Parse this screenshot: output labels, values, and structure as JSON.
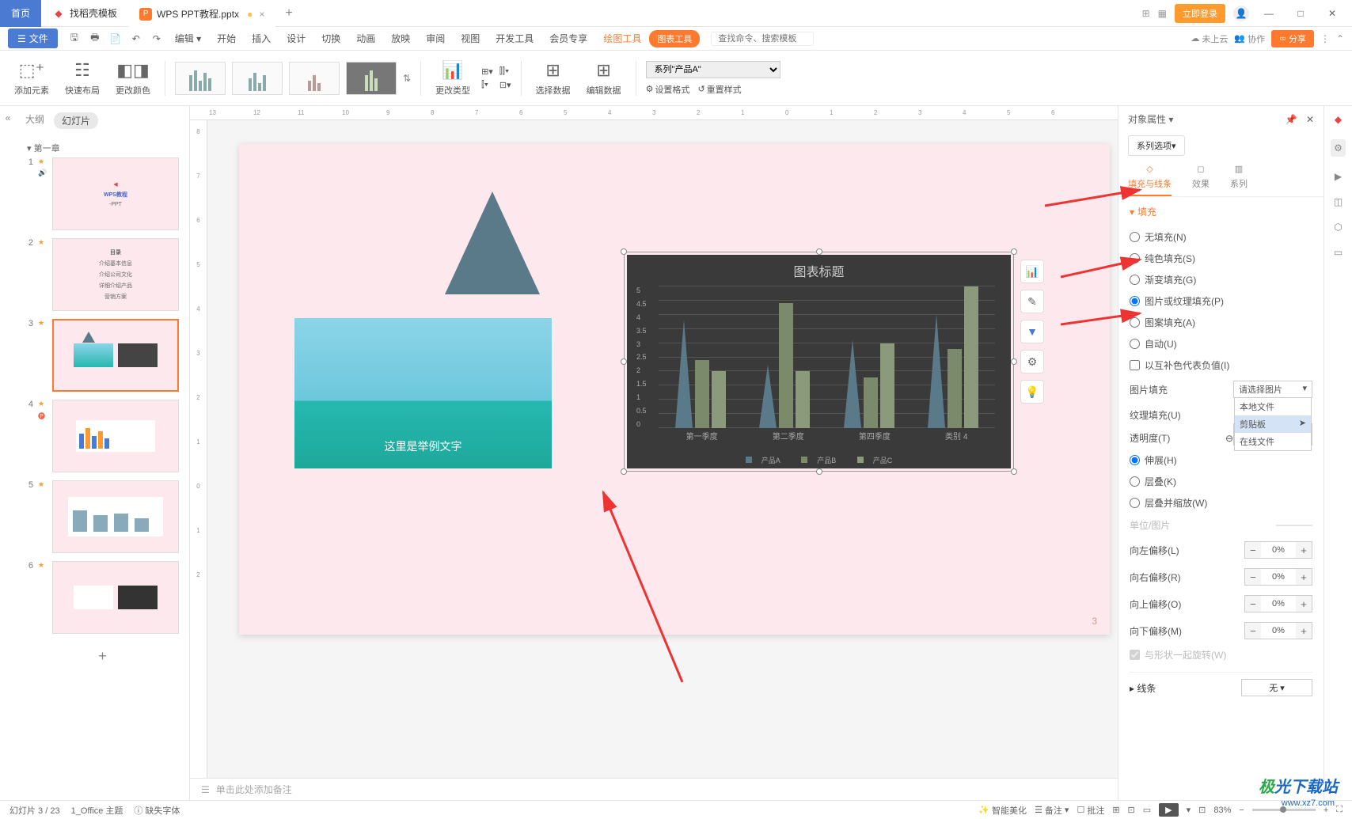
{
  "titlebar": {
    "home": "首页",
    "template_tab": "找稻壳模板",
    "doc_tab": "WPS PPT教程.pptx",
    "login": "立即登录"
  },
  "menubar": {
    "file": "文件",
    "edit": "编辑",
    "items": [
      "开始",
      "插入",
      "设计",
      "切换",
      "动画",
      "放映",
      "审阅",
      "视图",
      "开发工具",
      "会员专享"
    ],
    "draw_tool": "绘图工具",
    "chart_tool": "图表工具",
    "search_placeholder": "查找命令、搜索模板",
    "cloud": "未上云",
    "collab": "协作",
    "share": "分享"
  },
  "ribbon": {
    "add_element": "添加元素",
    "quick_layout": "快速布局",
    "change_color": "更改颜色",
    "change_type": "更改类型",
    "select_data": "选择数据",
    "edit_data": "编辑数据",
    "series_select": "系列\"产品A\"",
    "set_format": "设置格式",
    "reset_style": "重置样式"
  },
  "slidepanel": {
    "outline_tab": "大纲",
    "slides_tab": "幻灯片",
    "chapter": "第一章",
    "slide1_title": "WPS教程",
    "slide1_sub": "-PPT",
    "slide2_title": "目录",
    "slide2_items": [
      "介绍基本信息",
      "介绍公司文化",
      "详细介绍产品",
      "营销方案"
    ]
  },
  "canvas": {
    "beach_caption": "这里是举例文字",
    "page_num": "3"
  },
  "chart_data": {
    "type": "bar",
    "title": "图表标题",
    "categories": [
      "第一季度",
      "第二季度",
      "第四季度",
      "类别 4"
    ],
    "series": [
      {
        "name": "产品A",
        "values": [
          4.3,
          2.5,
          3.5,
          4.5
        ]
      },
      {
        "name": "产品B",
        "values": [
          2.4,
          4.4,
          1.8,
          2.8
        ]
      },
      {
        "name": "产品C",
        "values": [
          2.0,
          2.0,
          3.0,
          5.0
        ]
      }
    ],
    "ylim": [
      0,
      5
    ],
    "yticks": [
      "0",
      "0.5",
      "1",
      "1.5",
      "2",
      "2.5",
      "3",
      "3.5",
      "4",
      "4.5",
      "5"
    ]
  },
  "props": {
    "header": "对象属性",
    "series_opt": "系列选项",
    "tab_fill": "填充与线条",
    "tab_effect": "效果",
    "tab_series": "系列",
    "fill_section": "填充",
    "fill_none": "无填充(N)",
    "fill_solid": "纯色填充(S)",
    "fill_gradient": "渐变填充(G)",
    "fill_picture": "图片或纹理填充(P)",
    "fill_pattern": "图案填充(A)",
    "fill_auto": "自动(U)",
    "invert_neg": "以互补色代表负值(I)",
    "pic_fill": "图片填充",
    "pic_select": "请选择图片",
    "pic_opt1": "本地文件",
    "pic_opt2": "剪贴板",
    "pic_opt3": "在线文件",
    "texture_fill": "纹理填充(U)",
    "opacity": "透明度(T)",
    "stretch": "伸展(H)",
    "stack": "层叠(K)",
    "stack_scale": "层叠并缩放(W)",
    "unit": "单位/图片",
    "off_left": "向左偏移(L)",
    "off_right": "向右偏移(R)",
    "off_top": "向上偏移(O)",
    "off_bottom": "向下偏移(M)",
    "off_val": "0%",
    "rotate_with": "与形状一起旋转(W)",
    "line_section": "线条",
    "line_none": "无"
  },
  "notes": "单击此处添加备注",
  "status": {
    "slide_pos": "幻灯片 3 / 23",
    "theme": "1_Office 主题",
    "missing_font": "缺失字体",
    "beautify": "智能美化",
    "notes_btn": "备注",
    "review_btn": "批注",
    "zoom": "83%"
  },
  "watermark": {
    "brand": "极光下载站",
    "url": "www.xz7.com"
  }
}
